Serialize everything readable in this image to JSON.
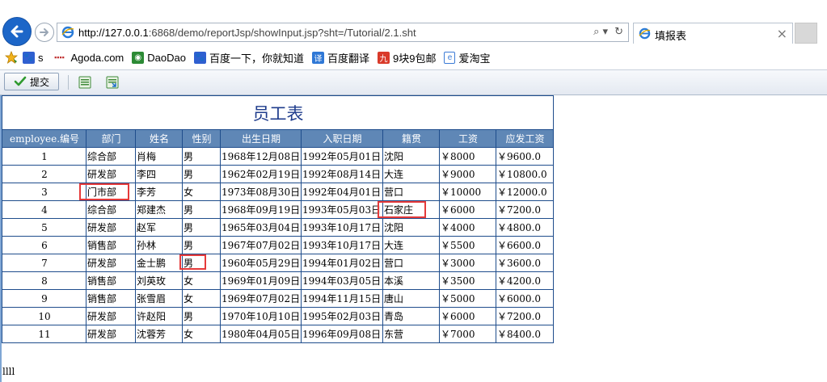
{
  "browser": {
    "url_host": "http://127.0.0.1",
    "url_rest": ":6868/demo/reportJsp/showInput.jsp?sht=/Tutorial/2.1.sht",
    "tab_title": "填报表",
    "tab_close": "×",
    "addr_tools": [
      "⌕ ▾",
      "↻"
    ]
  },
  "favorites": [
    {
      "label": "s",
      "icon": "paw-icon",
      "color": "#2f5fd0"
    },
    {
      "label": "Agoda.com",
      "icon": "agoda-icon",
      "color": "#c03030"
    },
    {
      "label": "DaoDao",
      "icon": "owl-icon",
      "color": "#2c8a35"
    },
    {
      "label": "百度一下，你就知道",
      "icon": "paw-icon",
      "color": "#2f5fd0"
    },
    {
      "label": "百度翻译",
      "icon": "translate-icon",
      "color": "#2f78d6"
    },
    {
      "label": "9块9包邮",
      "icon": "nine-icon",
      "color": "#d93a2a"
    },
    {
      "label": "爱淘宝",
      "icon": "page-icon",
      "color": "#3b7bd6"
    }
  ],
  "toolbar": {
    "submit_label": "提交"
  },
  "report": {
    "title": "员工表",
    "headers": [
      "employee.编号",
      "部门",
      "姓名",
      "性别",
      "出生日期",
      "入职日期",
      "籍贯",
      "工资",
      "应发工资"
    ],
    "rows": [
      [
        "1",
        "综合部",
        "肖梅",
        "男",
        "1968年12月08日",
        "1992年05月01日",
        "沈阳",
        "￥8000",
        "￥9600.0"
      ],
      [
        "2",
        "研发部",
        "李四",
        "男",
        "1962年02月19日",
        "1992年08月14日",
        "大连",
        "￥9000",
        "￥10800.0"
      ],
      [
        "3",
        "门市部",
        "李芳",
        "女",
        "1973年08月30日",
        "1992年04月01日",
        "营口",
        "￥10000",
        "￥12000.0"
      ],
      [
        "4",
        "综合部",
        "郑建杰",
        "男",
        "1968年09月19日",
        "1993年05月03日",
        "石家庄",
        "￥6000",
        "￥7200.0"
      ],
      [
        "5",
        "研发部",
        "赵军",
        "男",
        "1965年03月04日",
        "1993年10月17日",
        "沈阳",
        "￥4000",
        "￥4800.0"
      ],
      [
        "6",
        "销售部",
        "孙林",
        "男",
        "1967年07月02日",
        "1993年10月17日",
        "大连",
        "￥5500",
        "￥6600.0"
      ],
      [
        "7",
        "研发部",
        "金士鹏",
        "男",
        "1960年05月29日",
        "1994年01月02日",
        "营口",
        "￥3000",
        "￥3600.0"
      ],
      [
        "8",
        "销售部",
        "刘英玫",
        "女",
        "1969年01月09日",
        "1994年03月05日",
        "本溪",
        "￥3500",
        "￥4200.0"
      ],
      [
        "9",
        "销售部",
        "张雪眉",
        "女",
        "1969年07月02日",
        "1994年11月15日",
        "唐山",
        "￥5000",
        "￥6000.0"
      ],
      [
        "10",
        "研发部",
        "许赵阳",
        "男",
        "1970年10月10日",
        "1995年02月03日",
        "青岛",
        "￥6000",
        "￥7200.0"
      ],
      [
        "11",
        "研发部",
        "沈蓉芳",
        "女",
        "1980年04月05日",
        "1996年09月08日",
        "东营",
        "￥7000",
        "￥8400.0"
      ]
    ]
  },
  "footer_text": "llll"
}
